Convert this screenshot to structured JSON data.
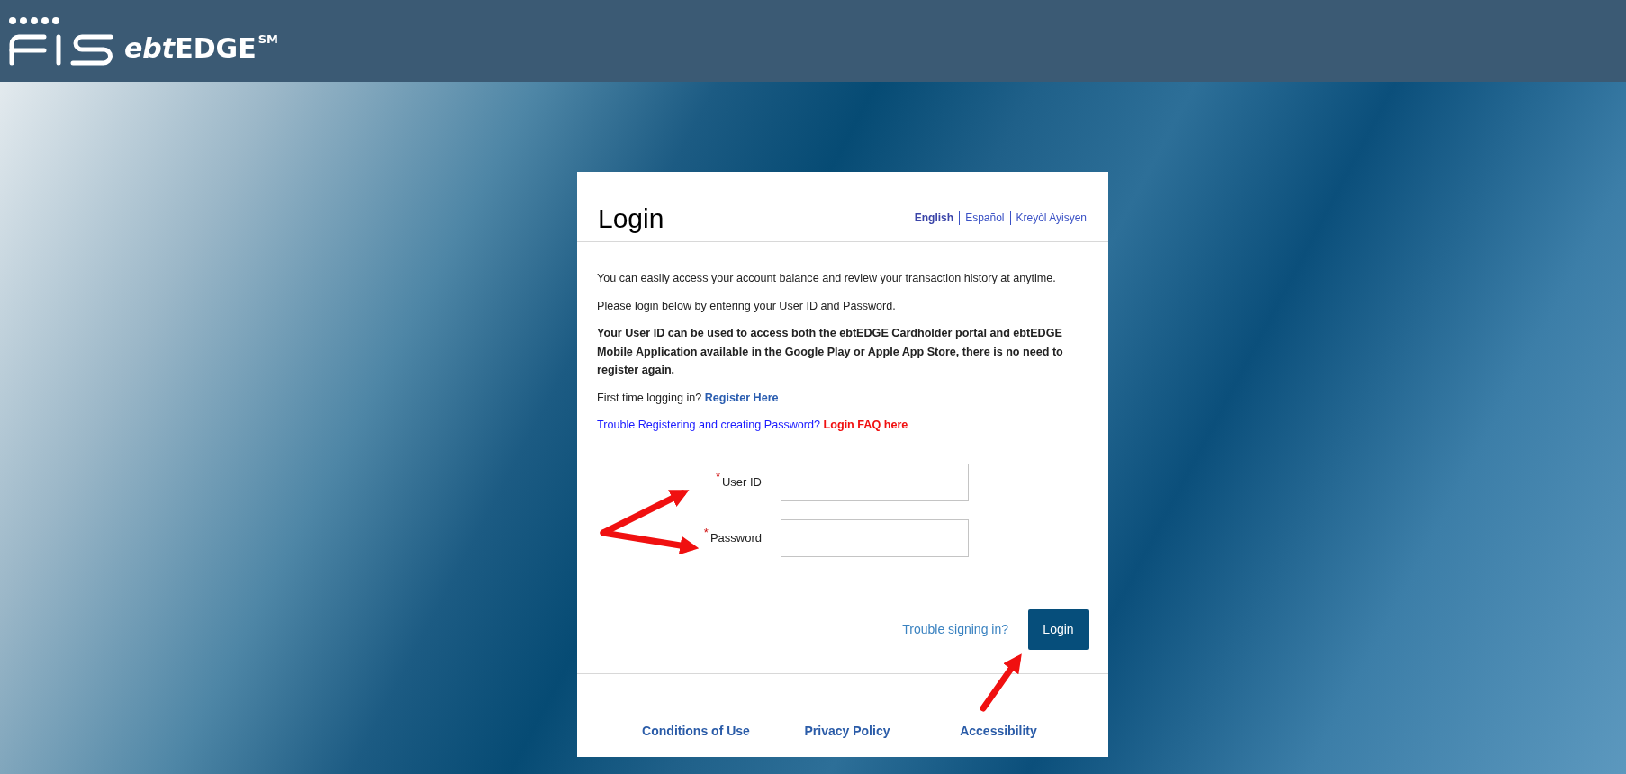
{
  "header": {
    "logo_product": "ebt",
    "logo_product_bold": "EDGE",
    "logo_mark": "SM"
  },
  "card": {
    "title": "Login",
    "languages": [
      {
        "label": "English",
        "selected": true
      },
      {
        "label": "Español",
        "selected": false
      },
      {
        "label": "Kreyòl Ayisyen",
        "selected": false
      }
    ],
    "paragraphs": [
      {
        "kind": "plain",
        "text": "You can easily access your account balance and review your transaction history at anytime."
      },
      {
        "kind": "plain",
        "text": "Please login below by entering your User ID and Password."
      },
      {
        "kind": "bold",
        "text": "Your User ID can be used to access both the ebtEDGE Cardholder portal and ebtEDGE Mobile Application available in the Google Play or Apple App Store, there is no need to register again."
      },
      {
        "kind": "link",
        "text": "First time logging in?",
        "link": "Register Here"
      },
      {
        "kind": "help",
        "text": "Trouble Registering and creating Password?",
        "link": "Login FAQ here"
      }
    ],
    "fields": [
      {
        "label": "User ID",
        "marker": "*"
      },
      {
        "label": "Password",
        "marker": "*"
      }
    ],
    "trouble_link": "Trouble signing in?",
    "login_button": "Login",
    "footer_links": [
      "Conditions of Use",
      "Privacy Policy",
      "Accessibility"
    ]
  }
}
